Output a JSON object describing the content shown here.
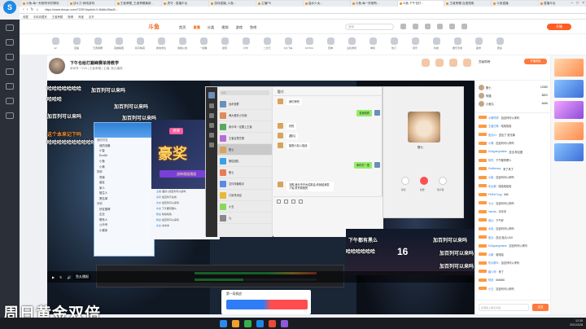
{
  "browser": {
    "tabs": [
      "斗鱼-每一秒都有你的精彩",
      "战斗力-网络游戏",
      "王者荣耀_王者荣耀最新...",
      "虎牙 - 直播平台",
      "游戏直播_斗鱼...",
      "主播PK",
      "盐水少女...",
      "斗鱼-每一秒都有...",
      "斗鱼-下午也打...",
      "王者荣耀-百度搜索",
      "斗鱼直播",
      "直播平台"
    ],
    "active_tab": 8,
    "url": "https://www.douyu.com/7226?dyshid=0-f6d6c28ad5...",
    "bookmarks": [
      "收藏",
      "手机收藏夹",
      "王者荣耀",
      "微博",
      "淘宝",
      "京东"
    ]
  },
  "douyu": {
    "logo": "斗鱼",
    "nav": [
      "首页",
      "直播",
      "分类",
      "视频",
      "游戏",
      "鱼吧"
    ],
    "active_nav": 1,
    "search_placeholder": "搜索",
    "open_live": "开播",
    "categories": [
      "12",
      "直播",
      "王者荣耀",
      "英雄联盟",
      "和平精英",
      "绝地求生",
      "穿越火线",
      "一起看",
      "颜值",
      "户外",
      "二次元",
      "QQ飞车",
      "DOTA2",
      "原神",
      "主机游戏",
      "单机",
      "热门",
      "音乐",
      "科技",
      "娱乐天地",
      "星秀",
      "更多"
    ]
  },
  "room": {
    "title": "下午也给打巅峰赛单排教学",
    "meta": "房间号: 7226  | 王者荣耀 | 主播: 鱼丸播报",
    "rank_title": "贡献周榜",
    "rank_button": "开通贵族"
  },
  "danmaku": [
    "哈哈哈哈哈哈哈",
    "加百列可以来吗",
    "哈哈哈",
    "加百列可以来吗",
    "加百列可以来吗",
    "加百列可以来吗",
    "哈哈哈哈哈哈哈哈哈哈",
    "这个本来记下吗",
    "加百列可以来吗",
    "加百列可以来吗",
    "加百列可以来吗",
    "下午都有黑么",
    "哈哈哈哈哈哈"
  ],
  "qq_contacts": [
    "我的好友",
    "我的设备",
    "小智",
    "EcoDir",
    "小鱼",
    "小美",
    "群聊",
    "同事",
    "朋友",
    "家人",
    "陌生人",
    "黑名单",
    "其他",
    "好友推荐",
    "企业",
    "联系人",
    "公众号",
    "小程序"
  ],
  "promo": {
    "label": "想要",
    "big": "豪奖",
    "sub": "战神通道通道"
  },
  "group_lines": [
    {
      "name": "主播",
      "text": "[图片] 加百列可以来吗"
    },
    {
      "name": "房管",
      "text": "加百列不在线"
    },
    {
      "name": "水友",
      "text": "加百列可以来吗"
    },
    {
      "name": "水友",
      "text": "下午都有黑么"
    },
    {
      "name": "粉丝",
      "text": "哈哈哈哈"
    },
    {
      "name": "粉丝",
      "text": "加百列可以来吗"
    },
    {
      "name": "水友",
      "text": "冲冲冲"
    }
  ],
  "wechat": {
    "search": "搜索",
    "chats": [
      {
        "name": "战术室群",
        "preview": "",
        "color": "#6a8fb8"
      },
      {
        "name": "海大爱情小天使",
        "preview": "",
        "color": "#e08a5a"
      },
      {
        "name": "我今年一定要上王者",
        "preview": "",
        "color": "#5aa860"
      },
      {
        "name": "王者百里玄策",
        "preview": "",
        "color": "#b86ad8"
      },
      {
        "name": "骰七",
        "preview": "",
        "color": "#d8a35a"
      },
      {
        "name": "微信团队",
        "preview": "",
        "color": "#3aa0e8"
      },
      {
        "name": "骰七",
        "preview": "",
        "color": "#e87a5a"
      },
      {
        "name": "文件传输助手",
        "preview": "",
        "color": "#5a8ae8"
      },
      {
        "name": "订阅号消息",
        "preview": "",
        "color": "#e8b83a"
      },
      {
        "name": "小丑",
        "preview": "",
        "color": "#8ad85a"
      },
      {
        "name": "九",
        "preview": "",
        "color": "#888888"
      }
    ],
    "selected": 4,
    "chat_title": "骰七",
    "messages": [
      {
        "side": "l",
        "text": "我们来吧"
      },
      {
        "side": "r",
        "text": "发我看看"
      },
      {
        "side": "l",
        "text": "好的"
      },
      {
        "side": "l",
        "text": "[图片]"
      },
      {
        "side": "l",
        "text": "接受小加入挑战"
      },
      {
        "side": "r",
        "text": "和你打一把"
      },
      {
        "side": "l",
        "text": "冲鸭,我分不开大招机会,你就给我发了哈,重开算我的"
      }
    ],
    "send": "发送(S)"
  },
  "video_call": {
    "name": "骰七",
    "controls": [
      "静音",
      "挂断",
      "扬声器"
    ]
  },
  "live_card": {
    "title": "第一局挑战",
    "num": "16"
  },
  "bottom_caption": "周日黄金双倍",
  "streamer_name": "鱼丸播报",
  "chat_panel": {
    "ranks": [
      {
        "name": "骰七",
        "value": "12580"
      },
      {
        "name": "阿福",
        "value": "8800"
      },
      {
        "name": "小鱼丸",
        "value": "6666"
      }
    ],
    "messages": [
      {
        "name": "小明同学:",
        "text": "加百列可以来吗"
      },
      {
        "name": "王者归来:",
        "text": "哈哈哈哈"
      },
      {
        "name": "鱼丸01:",
        "text": "送出了 荧光棒"
      },
      {
        "name": "小葵:",
        "text": "加百列可以来吗"
      },
      {
        "name": "Dollyyangmakie:",
        "text": "送出 粉丝团"
      },
      {
        "name": "阿杰:",
        "text": "下午都有黑么"
      },
      {
        "name": "Subliterary:",
        "text": "来了来了"
      },
      {
        "name": "小鱼:",
        "text": "加百列可以来吗"
      },
      {
        "name": "灰太狼:",
        "text": "哈哈哈哈哈"
      },
      {
        "name": "FMKeiTung:",
        "text": "666"
      },
      {
        "name": "七七:",
        "text": "加百列可以来吗"
      },
      {
        "name": "hahala:",
        "text": "冲冲冲"
      },
      {
        "name": "西瓜:",
        "text": "下午好"
      },
      {
        "name": "水友:",
        "text": "加百列可以来吗"
      },
      {
        "name": "鱼丸:",
        "text": "送出 鱼丸×100"
      },
      {
        "name": "Dollyyangmakie:",
        "text": "加百列可以来吗"
      },
      {
        "name": "小新:",
        "text": "哈哈哈"
      },
      {
        "name": "吃瓜群众:",
        "text": "加百列可以来吗"
      },
      {
        "name": "路人甲:",
        "text": "来了"
      },
      {
        "name": "阿花:",
        "text": "666666"
      },
      {
        "name": "小王:",
        "text": "加百列可以来吗"
      }
    ],
    "input_placeholder": "这里输入聊天内容",
    "send": "发送"
  },
  "clock": {
    "time": "12:35",
    "date": "2021/3/28"
  }
}
